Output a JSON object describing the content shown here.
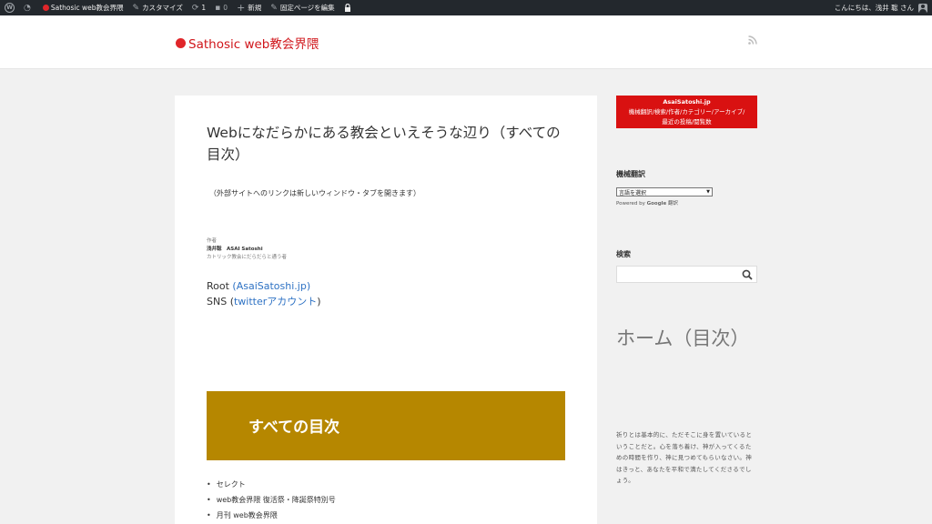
{
  "adminbar": {
    "site_name": "Sathosic web教会界隈",
    "customize": "カスタマイズ",
    "updates_count": "1",
    "comments_count": "0",
    "new": "新規",
    "edit_page": "固定ページを編集",
    "greeting": "こんにちは、浅井 聡 さん"
  },
  "header": {
    "site_title": "Sathosic web教会界隈"
  },
  "post": {
    "title": "Webになだらかにある教会といえそうな辺り（すべての目次）",
    "external_note": "（外部サイトへのリンクは新しいウィンドウ・タブを開きます）",
    "author_label": "作者",
    "author_name": "浅井聡　ASAI Satoshi",
    "author_desc": "カトリック教会にだらだらと通う者",
    "root_prefix": "Root ",
    "root_link": "(AsaiSatoshi.jp)",
    "sns_prefix": "SNS (",
    "sns_link": "twitterアカウント",
    "sns_suffix": ")",
    "toc_banner": "すべての目次",
    "toc_items": [
      "セレクト",
      "web教会界隈 復活祭・降誕祭特別号",
      "月刊 web教会界隈"
    ]
  },
  "sidebar": {
    "red_widget": {
      "title": "AsaiSatoshi.jp",
      "line1": "機械翻訳/検索/作者/カテゴリー/アーカイブ/",
      "line2": "最近の投稿/閲覧数"
    },
    "translate_title": "機械翻訳",
    "translate_select": "言語を選択",
    "powered_prefix": "Powered by ",
    "powered_google": "Google",
    "powered_suffix": " 翻訳",
    "search_title": "検索",
    "search_placeholder": "",
    "home_heading": "ホーム（目次）",
    "prayer": "祈りとは基本的に、ただそこに身を置いているということだと。心を落ち着け、神が入ってくるための時間を作り、神に見つめてもらいなさい。神はきっと、あなたを平和で満たしてくださるでしょう。"
  },
  "colors": {
    "admin_bar": "#23282d",
    "accent_red": "#d0161b",
    "toc_gold": "#b68700",
    "link_blue": "#2e72c4"
  }
}
